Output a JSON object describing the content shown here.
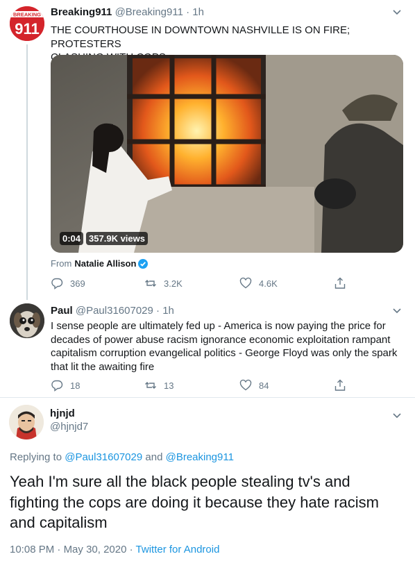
{
  "tweet1": {
    "name": "Breaking911",
    "handle": "@Breaking911",
    "separator": "·",
    "time": "1h",
    "avatar_text": "911",
    "avatar_small": "BREAKING",
    "text_line1": "THE COURTHOUSE IN DOWNTOWN NASHVILLE IS ON FIRE; PROTESTERS",
    "text_line2": "CLASHING WITH COPS",
    "video": {
      "duration": "0:04",
      "views": "357.9K views"
    },
    "from_label": "From",
    "from_name": "Natalie Allison",
    "replies": "369",
    "retweets": "3.2K",
    "likes": "4.6K"
  },
  "tweet2": {
    "name": "Paul",
    "handle": "@Paul31607029",
    "separator": "·",
    "time": "1h",
    "lines": [
      "I sense people are ultimately fed up - America is now paying the price for",
      "decades of power abuse racism ignorance economic exploitation rampant",
      "capitalism corruption evangelical politics -  George Floyd was only the spark",
      "that lit the awaiting fire"
    ],
    "replies": "18",
    "retweets": "13",
    "likes": "84"
  },
  "main": {
    "name": "hjnjd",
    "handle": "@hjnjd7",
    "replying_label": "Replying to",
    "reply_user1": "@Paul31607029",
    "and_label": "and",
    "reply_user2": "@Breaking911",
    "lines": [
      "Yeah I'm sure all the black people stealing tv's and",
      "fighting the cops are doing it because they hate racism",
      "and capitalism"
    ],
    "time": "10:08 PM",
    "separator": "·",
    "date": "May 30, 2020",
    "source": "Twitter for Android"
  },
  "colors": {
    "link": "#1b95e0",
    "muted": "#657786",
    "text": "#14171a",
    "brand_red": "#d4242b",
    "verified": "#1da1f2"
  }
}
